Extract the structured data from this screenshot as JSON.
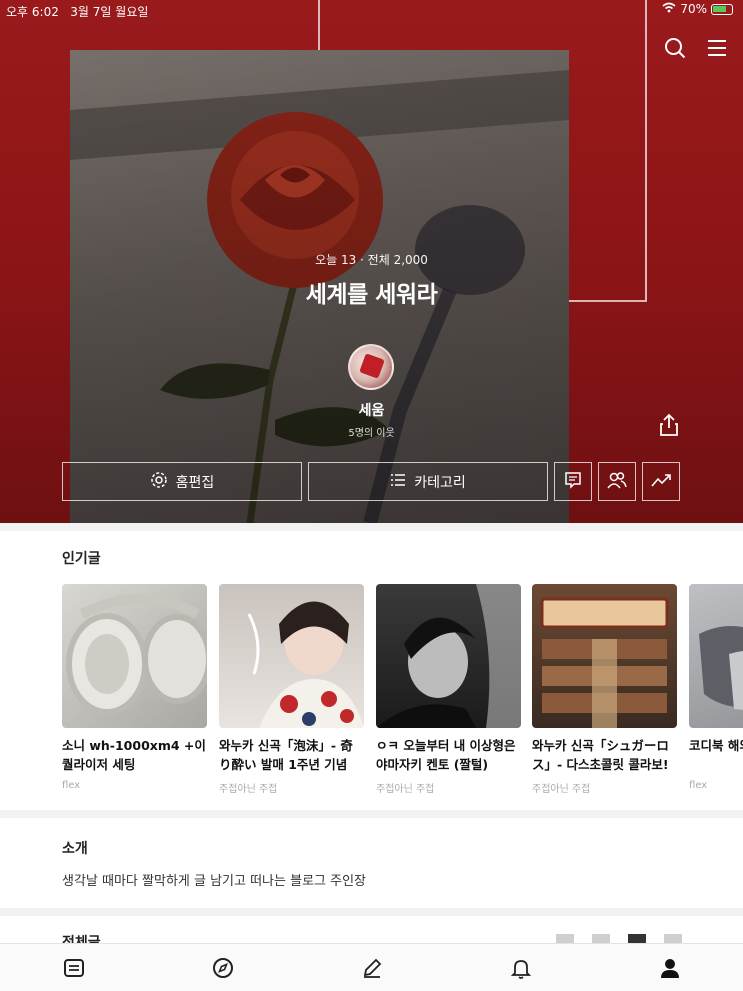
{
  "status": {
    "time": "오후 6:02",
    "date": "3월 7일 월요일",
    "battery": "70%"
  },
  "blog": {
    "visits": "오늘 13 · 전체 2,000",
    "title": "세계를 세워라",
    "owner": "세움",
    "neighbors": "5명의 이웃"
  },
  "actions": {
    "edit_label": "홈편집",
    "category_label": "카테고리"
  },
  "popular": {
    "title": "인기글",
    "items": [
      {
        "title": "소니 wh-1000xm4 +이퀄라이저 세팅",
        "meta": "flex"
      },
      {
        "title": "와누카 신곡「泡沫」- 奇り酔い 발매 1주년 기념 🎉",
        "meta": "주접아닌 주접"
      },
      {
        "title": "ㅇㅋ 오늘부터 내 이상형은 야마자키 켄토 (짤털)",
        "meta": "주접아닌 주접"
      },
      {
        "title": "와누카 신곡「シュガーロス」- 다스초콜릿 콜라보!",
        "meta": "주접아닌 주접"
      },
      {
        "title": "코디북 해외",
        "meta": "flex"
      }
    ]
  },
  "intro": {
    "title": "소개",
    "text": "생각날 때마다 짤막하게 글 남기고 떠나는 블로그 주인장"
  },
  "all_posts": {
    "title": "전체글"
  },
  "colors": {
    "hero": "#8a1416",
    "accent": "#c02025"
  },
  "icons": {
    "search": "search-icon",
    "menu": "menu-icon",
    "share": "share-icon",
    "tabs": [
      "feed-icon",
      "compass-icon",
      "pencil-icon",
      "bell-icon",
      "person-icon"
    ]
  }
}
